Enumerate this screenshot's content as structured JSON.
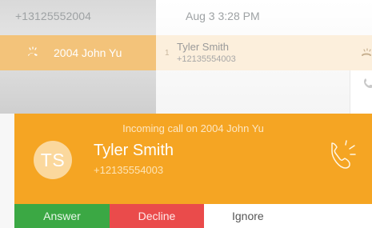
{
  "history": {
    "top_row": {
      "phone": "+13125552004",
      "date": "Aug 3 3:28 PM"
    },
    "selected_row": {
      "line_label": "2004 John Yu",
      "count": "1",
      "name": "Tyler Smith",
      "number": "+12135554003"
    }
  },
  "incoming": {
    "title": "Incoming call on 2004 John Yu",
    "avatar_initials": "TS",
    "caller_name": "Tyler Smith",
    "caller_number": "+12135554003",
    "icon": "incoming-call-icon"
  },
  "actions": {
    "answer_label": "Answer",
    "decline_label": "Decline",
    "ignore_label": "Ignore"
  },
  "colors": {
    "banner": "#f5a523",
    "answer": "#3ba844",
    "decline": "#ea4b4b",
    "selected_left": "#f3c37a",
    "selected_right": "#fcefdc"
  }
}
